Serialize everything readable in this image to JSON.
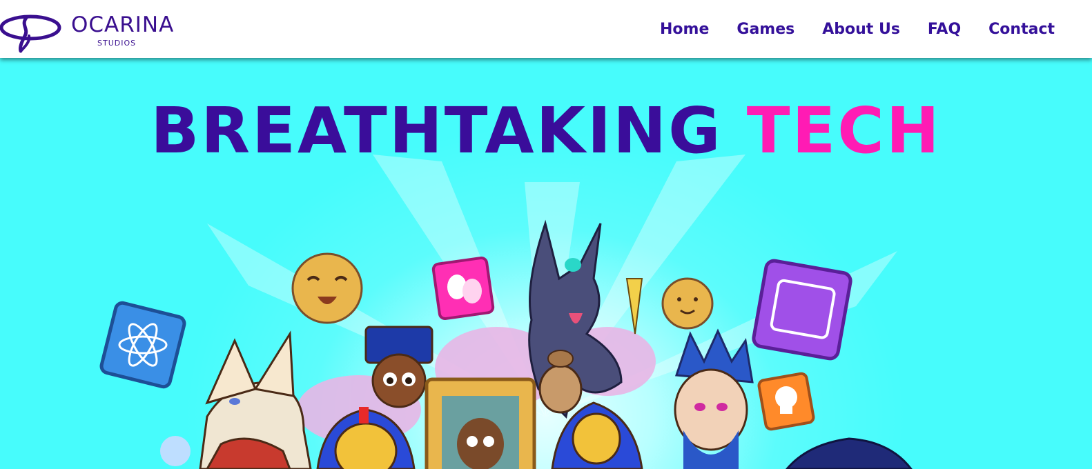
{
  "brand": {
    "name": "OCARINA",
    "subtitle": "STUDIOS",
    "color": "#3a0f8f"
  },
  "nav": {
    "items": [
      "Home",
      "Games",
      "About Us",
      "FAQ",
      "Contact"
    ],
    "color": "#34109a"
  },
  "hero": {
    "headline_part1": "BREATHTAKING",
    "headline_part2": "TECH",
    "part1_color": "#3a0d9a",
    "part2_color": "#ff1bb4",
    "background": "#47fcfc"
  }
}
